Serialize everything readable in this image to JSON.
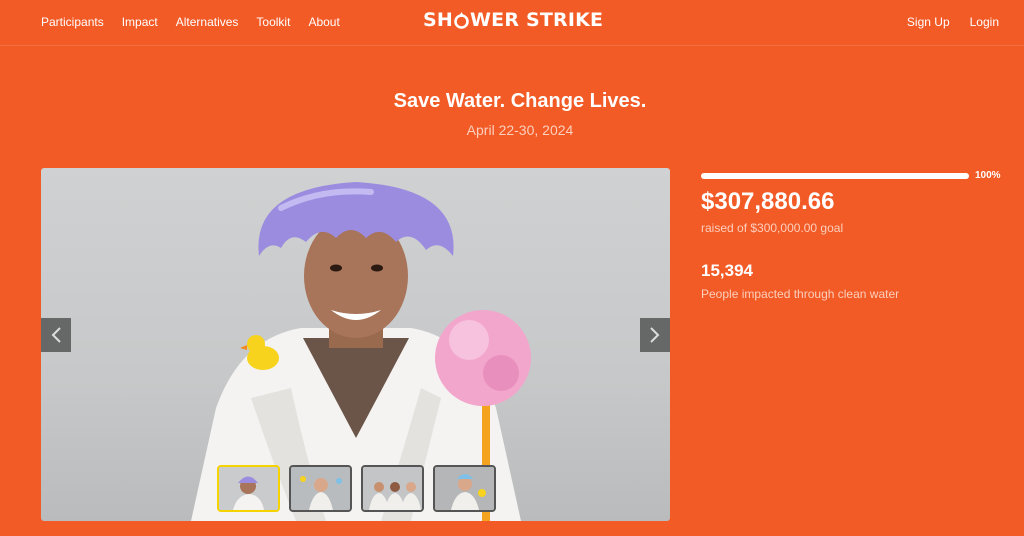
{
  "nav": {
    "links": [
      "Participants",
      "Impact",
      "Alternatives",
      "Toolkit",
      "About"
    ],
    "brand_left": "SH",
    "brand_right": "WER STRIKE",
    "sign_up": "Sign Up",
    "login": "Login"
  },
  "hero": {
    "title": "Save Water. Change Lives.",
    "dates": "April 22-30, 2024"
  },
  "carousel": {
    "prev_icon": "chevron-left-icon",
    "next_icon": "chevron-right-icon",
    "active_index": 0,
    "thumb_count": 4
  },
  "stats": {
    "progress_percent": 100,
    "progress_label": "100%",
    "amount_raised": "$307,880.66",
    "goal_text": "raised of $300,000.00 goal",
    "people_count": "15,394",
    "people_label": "People impacted through clean water"
  },
  "colors": {
    "background": "#f25a26",
    "active_thumb": "#f5d300"
  }
}
